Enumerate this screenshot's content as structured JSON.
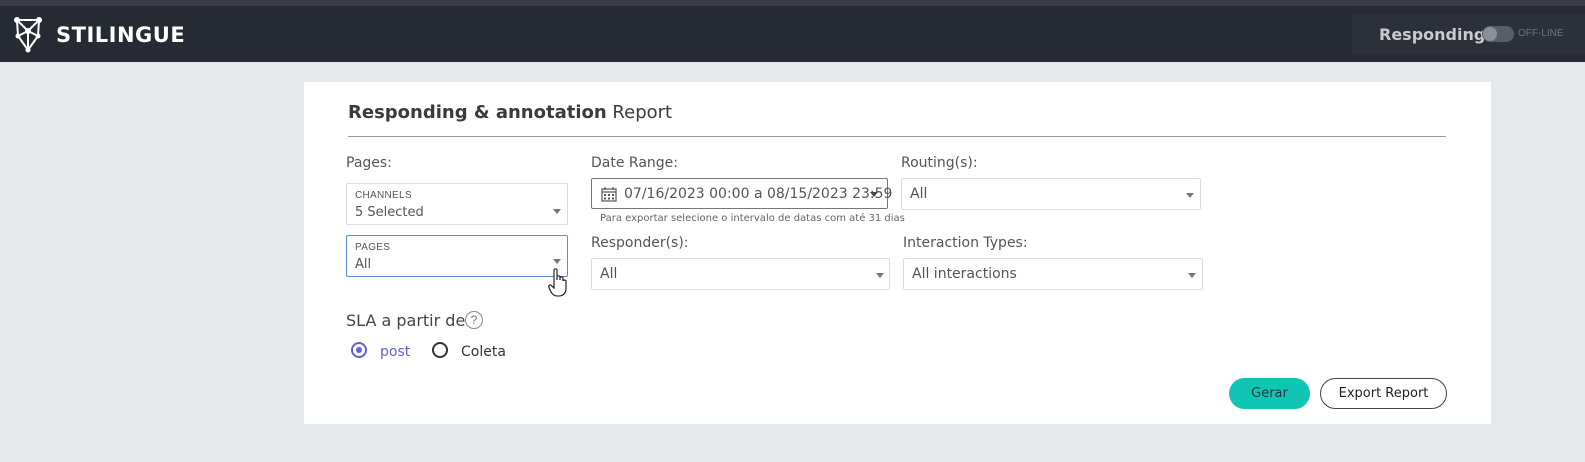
{
  "header": {
    "brand": "STILINGUE",
    "responding_label": "Responding",
    "toggle_text": "OFF-LINE",
    "toggle_on": false
  },
  "report": {
    "title_bold": "Responding & annotation",
    "title_light": "Report"
  },
  "filters": {
    "pages_label": "Pages:",
    "channels": {
      "caption": "CHANNELS",
      "value": "5 Selected"
    },
    "pages": {
      "caption": "PAGES",
      "value": "All"
    },
    "date_range_label": "Date Range:",
    "date_range_value": "07/16/2023 00:00 a 08/15/2023 23:59",
    "date_hint": "Para exportar selecione o intervalo de datas com até 31 dias",
    "routing_label": "Routing(s):",
    "routing_value": "All",
    "responder_label": "Responder(s):",
    "responder_value": "All",
    "interaction_label": "Interaction Types:",
    "interaction_value": "All interactions"
  },
  "sla": {
    "label": "SLA a partir de",
    "help": "?",
    "options": [
      {
        "label": "post",
        "selected": true
      },
      {
        "label": "Coleta",
        "selected": false
      }
    ]
  },
  "actions": {
    "generate": "Gerar",
    "export": "Export Report"
  },
  "colors": {
    "accent": "#11c5b5",
    "radio_selected": "#5d62d8",
    "topbar": "#262a33"
  }
}
